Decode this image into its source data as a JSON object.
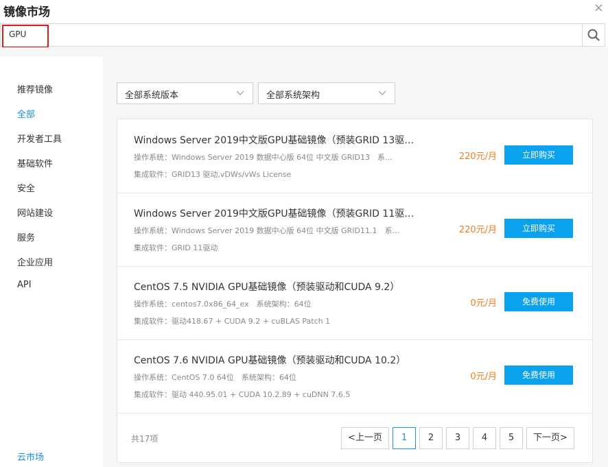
{
  "dialog": {
    "title": "镜像市场",
    "close_glyph": "×"
  },
  "search": {
    "value": "GPU",
    "icon": "search-icon"
  },
  "sidebar": {
    "items": [
      {
        "label": "推荐镜像",
        "active": false
      },
      {
        "label": "全部",
        "active": true
      },
      {
        "label": "开发者工具",
        "active": false
      },
      {
        "label": "基础软件",
        "active": false
      },
      {
        "label": "安全",
        "active": false
      },
      {
        "label": "网站建设",
        "active": false
      },
      {
        "label": "服务",
        "active": false
      },
      {
        "label": "企业应用",
        "active": false
      },
      {
        "label": "API",
        "active": false
      }
    ],
    "bottom_link": "云市场"
  },
  "filters": {
    "version": "全部系统版本",
    "arch": "全部系统架构"
  },
  "images": [
    {
      "name": "Windows Server 2019中文版GPU基础镜像（预装GRID 13驱…",
      "os": "操作系统：Windows Server 2019 数据中心版 64位 中文版 GRID13　系…",
      "software": "集成软件：GRID13 驱动,vDWs/vWs License",
      "price": "220元/月",
      "button": "立即购买"
    },
    {
      "name": "Windows Server 2019中文版GPU基础镜像（预装GRID 11驱…",
      "os": "操作系统：Windows Server 2019 数据中心版 64位 中文版 GRID11.1　系…",
      "software": "集成软件：GRID 11驱动",
      "price": "220元/月",
      "button": "立即购买"
    },
    {
      "name": "CentOS 7.5 NVIDIA GPU基础镜像（预装驱动和CUDA 9.2）",
      "os": "操作系统：centos7.0x86_64_ex　系统架构：64位",
      "software": "集成软件：驱动418.67 + CUDA 9.2 + cuBLAS Patch 1",
      "price": "0元/月",
      "button": "免费使用"
    },
    {
      "name": "CentOS 7.6 NVIDIA GPU基础镜像（预装驱动和CUDA 10.2）",
      "os": "操作系统：CentOS 7.0 64位　系统架构：64位",
      "software": "集成软件：驱动 440.95.01 + CUDA 10.2.89 + cuDNN 7.6.5",
      "price": "0元/月",
      "button": "免费使用"
    }
  ],
  "pagination": {
    "total": "共17项",
    "prev": "<上一页",
    "pages": [
      "1",
      "2",
      "3",
      "4",
      "5"
    ],
    "current": "1",
    "next": "下一页>"
  },
  "colors": {
    "accent": "#1a8fdd",
    "button": "#0aa1ed",
    "price": "#f07d1d",
    "highlight_border": "#e4191d"
  }
}
